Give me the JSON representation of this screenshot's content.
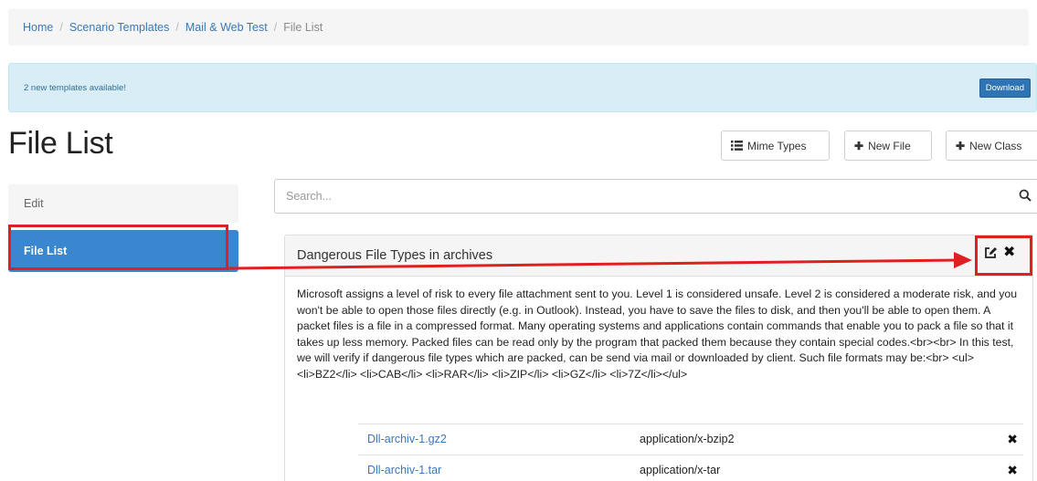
{
  "breadcrumb": {
    "home": "Home",
    "scenario_templates": "Scenario Templates",
    "mail_web_test": "Mail & Web Test",
    "current": "File List",
    "separator": "/"
  },
  "alert": {
    "text": "2 new templates available!",
    "download_label": "Download"
  },
  "page_title": "File List",
  "toolbar": {
    "mime_types_label": "Mime Types",
    "new_file_label": "New File",
    "new_class_label": "New Class"
  },
  "sidebar": {
    "items": [
      {
        "label": "Edit"
      },
      {
        "label": "File List"
      }
    ]
  },
  "search": {
    "placeholder": "Search..."
  },
  "panel": {
    "title": "Dangerous File Types in archives",
    "description": "Microsoft assigns a level of risk to every file attachment sent to you. Level 1 is considered unsafe. Level 2 is considered a moderate risk, and you won't be able to open those files directly (e.g. in Outlook). Instead, you have to save the files to disk, and then you'll be able to open them. A packet files is a file in a compressed format. Many operating systems and applications contain commands that enable you to pack a file so that it takes up less memory. Packed files can be read only by the program that packed them because they contain special codes.<br><br> In this test, we will verify if dangerous file types which are packed, can be send via mail or downloaded by client. Such file formats may be:<br> <ul><li>BZ2</li> <li>CAB</li> <li>RAR</li> <li>ZIP</li> <li>GZ</li> <li>7Z</li></ul>",
    "files": [
      {
        "name": "Dll-archiv-1.gz2",
        "mime": "application/x-bzip2"
      },
      {
        "name": "Dll-archiv-1.tar",
        "mime": "application/x-tar"
      }
    ]
  },
  "icons": {
    "list": "list-icon",
    "plus": "plus-icon",
    "search": "search-icon",
    "edit": "edit-icon",
    "close": "close-icon"
  },
  "colors": {
    "accent": "#3a87cf",
    "link": "#3a78b8",
    "alert_bg": "#d9edf7",
    "annotation": "#e02020"
  }
}
